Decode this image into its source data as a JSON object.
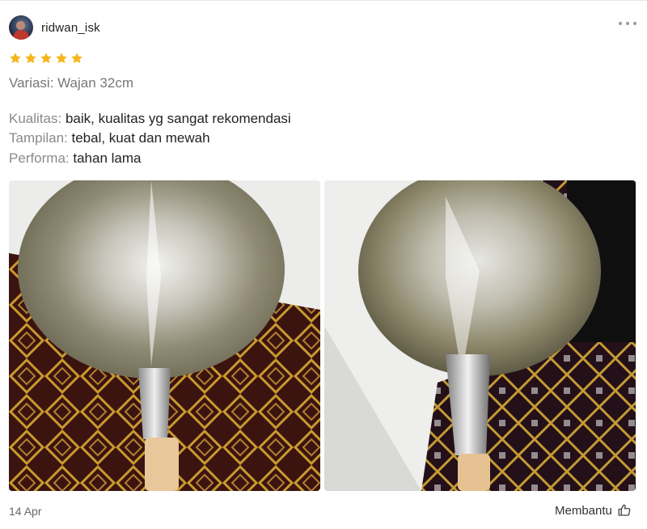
{
  "review": {
    "username": "ridwan_isk",
    "rating": 5,
    "variant": "Variasi: Wajan 32cm",
    "fields": [
      {
        "label": "Kualitas:",
        "value": "baik, kualitas yg sangat rekomendasi"
      },
      {
        "label": "Tampilan:",
        "value": "tebal, kuat dan mewah"
      },
      {
        "label": "Performa:",
        "value": "tahan lama"
      }
    ],
    "date": "14 Apr",
    "helpful_label": "Membantu"
  },
  "icons": {
    "more": "more-horizontal-icon",
    "star": "star-icon",
    "thumb": "thumbs-up-icon"
  },
  "colors": {
    "star": "#f5b51d",
    "label": "#8a8a8a",
    "text": "#222222"
  }
}
